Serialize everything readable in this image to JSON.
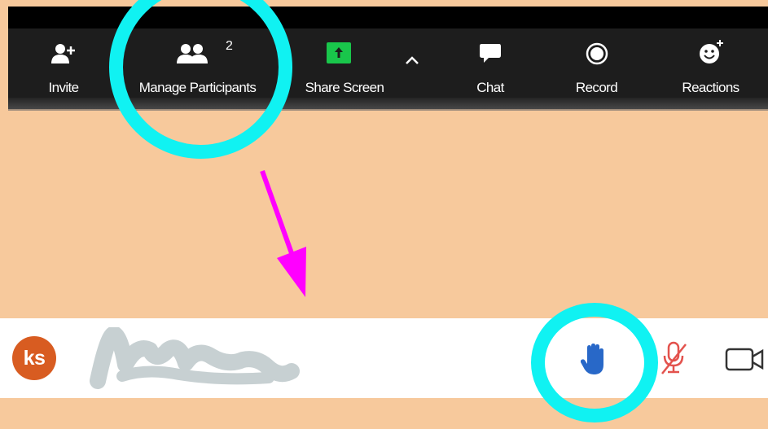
{
  "toolbar": {
    "invite": {
      "label": "Invite",
      "icon": "invite-icon"
    },
    "participants": {
      "label": "Manage Participants",
      "count": "2",
      "icon": "participants-icon"
    },
    "share": {
      "label": "Share Screen",
      "icon": "share-screen-icon"
    },
    "chat": {
      "label": "Chat",
      "icon": "chat-icon"
    },
    "record": {
      "label": "Record",
      "icon": "record-icon"
    },
    "reactions": {
      "label": "Reactions",
      "icon": "reactions-icon"
    }
  },
  "participant": {
    "initials": "ks",
    "avatar_color": "#d85c21"
  },
  "colors": {
    "highlight": "#10f2f2",
    "arrow": "#ff00ff",
    "background": "#f7c99c",
    "share_green": "#19c64b",
    "hand_blue": "#2868c8",
    "muted_red": "#e3524d"
  }
}
